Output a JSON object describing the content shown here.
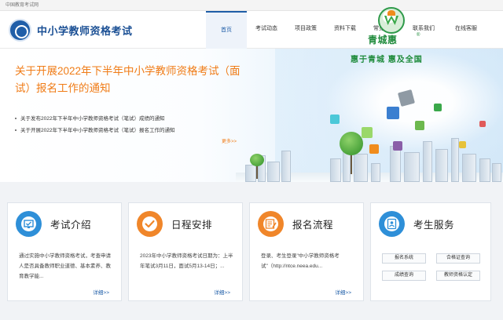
{
  "topbar": {
    "site_name": "中国教育考试网"
  },
  "header": {
    "title": "中小学教师资格考试"
  },
  "nav": {
    "items": [
      {
        "label": "首页",
        "active": true
      },
      {
        "label": "考试动态",
        "active": false
      },
      {
        "label": "项目政策",
        "active": false
      },
      {
        "label": "资料下载",
        "active": false
      },
      {
        "label": "常见问题",
        "active": false
      },
      {
        "label": "联系我们",
        "active": false
      },
      {
        "label": "在线客服",
        "active": false
      }
    ]
  },
  "badge": {
    "name": "青城惠",
    "registered": "®",
    "slogan": "惠于青城  惠及全国"
  },
  "hero": {
    "headline": "关于开展2022年下半年中小学教师资格考试（面试）报名工作的通知",
    "news": [
      "关于发布2022年下半年中小学教师资格考试（笔试）成绩的通知",
      "关于开展2022年下半年中小学教师资格考试（笔试）报名工作的通知"
    ],
    "more": "更多>>"
  },
  "cards": [
    {
      "title": "考试介绍",
      "icon": "monitor-check-icon",
      "text": "通过实施中小学教师资格考试，考查申请人是否具备教师职业道德、基本素养、教育教学能...",
      "more": "详细>>"
    },
    {
      "title": "日程安排",
      "icon": "checkmark-icon",
      "text": "2023年中小学教师资格考试日期为：上半年笔试3月11日，面试5月13-14日；...",
      "more": "详细>>"
    },
    {
      "title": "报名流程",
      "icon": "form-edit-icon",
      "text": "登录、考生登录\"中小学教师资格考试\"（http://ntce.neea.edu...",
      "more": "详细>>"
    },
    {
      "title": "考生服务",
      "icon": "contacts-icon",
      "buttons": [
        "报名系统",
        "合格证查询",
        "成绩查询",
        "教师资格认定"
      ]
    }
  ],
  "colors": {
    "brand_blue": "#1f5ea8",
    "accent_orange": "#f07c17",
    "badge_green": "#1d8a3a",
    "card_icon_blue": "#2e8fd8",
    "card_icon_orange": "#f0862a"
  }
}
